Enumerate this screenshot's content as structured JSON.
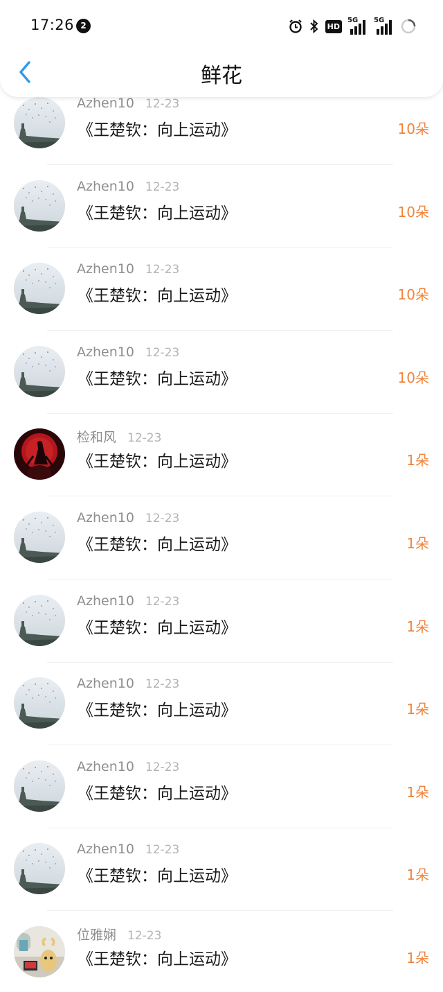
{
  "status_bar": {
    "time": "17:26",
    "notification_count": "2",
    "hd_label": "HD",
    "network_1": "5G",
    "network_2": "5G"
  },
  "header": {
    "title": "鲜花",
    "back_icon": "chevron-left-icon",
    "accent_color": "#2f9be8"
  },
  "list": {
    "count_color": "#f0833a",
    "items": [
      {
        "user": "Azhen10",
        "date": "12-23",
        "title": "《王楚钦：向上运动》",
        "count": "10朵",
        "avatar": "tower-birds"
      },
      {
        "user": "Azhen10",
        "date": "12-23",
        "title": "《王楚钦：向上运动》",
        "count": "10朵",
        "avatar": "tower-birds"
      },
      {
        "user": "Azhen10",
        "date": "12-23",
        "title": "《王楚钦：向上运动》",
        "count": "10朵",
        "avatar": "tower-birds"
      },
      {
        "user": "Azhen10",
        "date": "12-23",
        "title": "《王楚钦：向上运动》",
        "count": "10朵",
        "avatar": "tower-birds"
      },
      {
        "user": "检和风",
        "date": "12-23",
        "title": "《王楚钦：向上运动》",
        "count": "1朵",
        "avatar": "red-moon"
      },
      {
        "user": "Azhen10",
        "date": "12-23",
        "title": "《王楚钦：向上运动》",
        "count": "1朵",
        "avatar": "tower-birds"
      },
      {
        "user": "Azhen10",
        "date": "12-23",
        "title": "《王楚钦：向上运动》",
        "count": "1朵",
        "avatar": "tower-birds"
      },
      {
        "user": "Azhen10",
        "date": "12-23",
        "title": "《王楚钦：向上运动》",
        "count": "1朵",
        "avatar": "tower-birds"
      },
      {
        "user": "Azhen10",
        "date": "12-23",
        "title": "《王楚钦：向上运动》",
        "count": "1朵",
        "avatar": "tower-birds"
      },
      {
        "user": "Azhen10",
        "date": "12-23",
        "title": "《王楚钦：向上运动》",
        "count": "1朵",
        "avatar": "tower-birds"
      },
      {
        "user": "位雅娴",
        "date": "12-23",
        "title": "《王楚钦：向上运动》",
        "count": "1朵",
        "avatar": "cartoon-room"
      }
    ]
  }
}
